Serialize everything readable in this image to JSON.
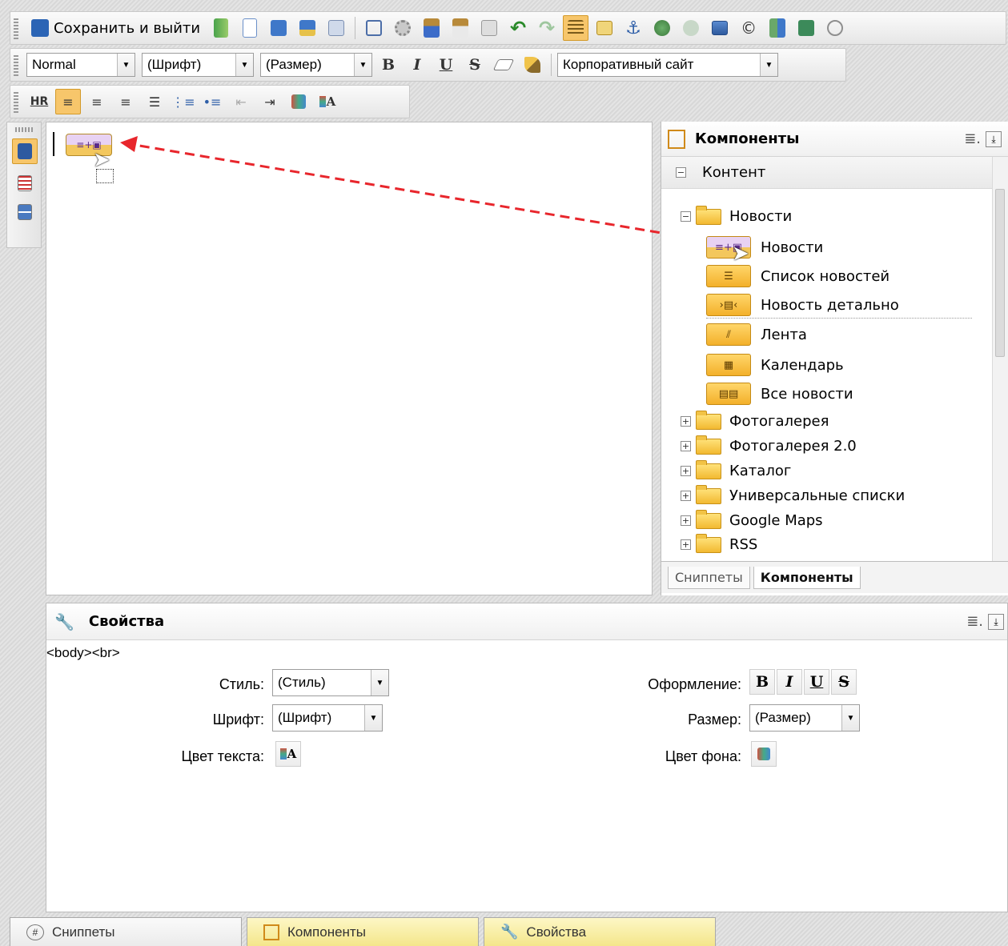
{
  "toolbar1": {
    "save_exit_label": "Сохранить и выйти"
  },
  "toolbar2": {
    "style_select": "Normal",
    "font_select": "(Шрифт)",
    "size_select": "(Размер)",
    "bold": "B",
    "italic": "I",
    "underline": "U",
    "strike": "S",
    "template_select": "Корпоративный сайт"
  },
  "toolbar3": {
    "hr_label": "HR"
  },
  "components_panel": {
    "title": "Компоненты",
    "section": "Контент",
    "tree": {
      "news_folder": "Новости",
      "items": [
        "Новости",
        "Список новостей",
        "Новость детально",
        "Лента",
        "Календарь",
        "Все новости"
      ],
      "folders": [
        "Фотогалерея",
        "Фотогалерея 2.0",
        "Каталог",
        "Универсальные списки",
        "Google Maps",
        "RSS"
      ]
    },
    "tabs": [
      "Сниппеты",
      "Компоненты"
    ]
  },
  "properties": {
    "title": "Свойства",
    "path": "<body><br>",
    "style_label": "Стиль:",
    "style_value": "(Стиль)",
    "font_label": "Шрифт:",
    "font_value": "(Шрифт)",
    "text_color_label": "Цвет текста:",
    "decoration_label": "Оформление:",
    "size_label": "Размер:",
    "size_value": "(Размер)",
    "bg_color_label": "Цвет фона:"
  },
  "bottom_tabs": [
    "Сниппеты",
    "Компоненты",
    "Свойства"
  ],
  "colors": {
    "accent_orange": "#f7c66b",
    "drag_arrow": "#e8262c",
    "tab_yellow": "#fbf2a8"
  }
}
